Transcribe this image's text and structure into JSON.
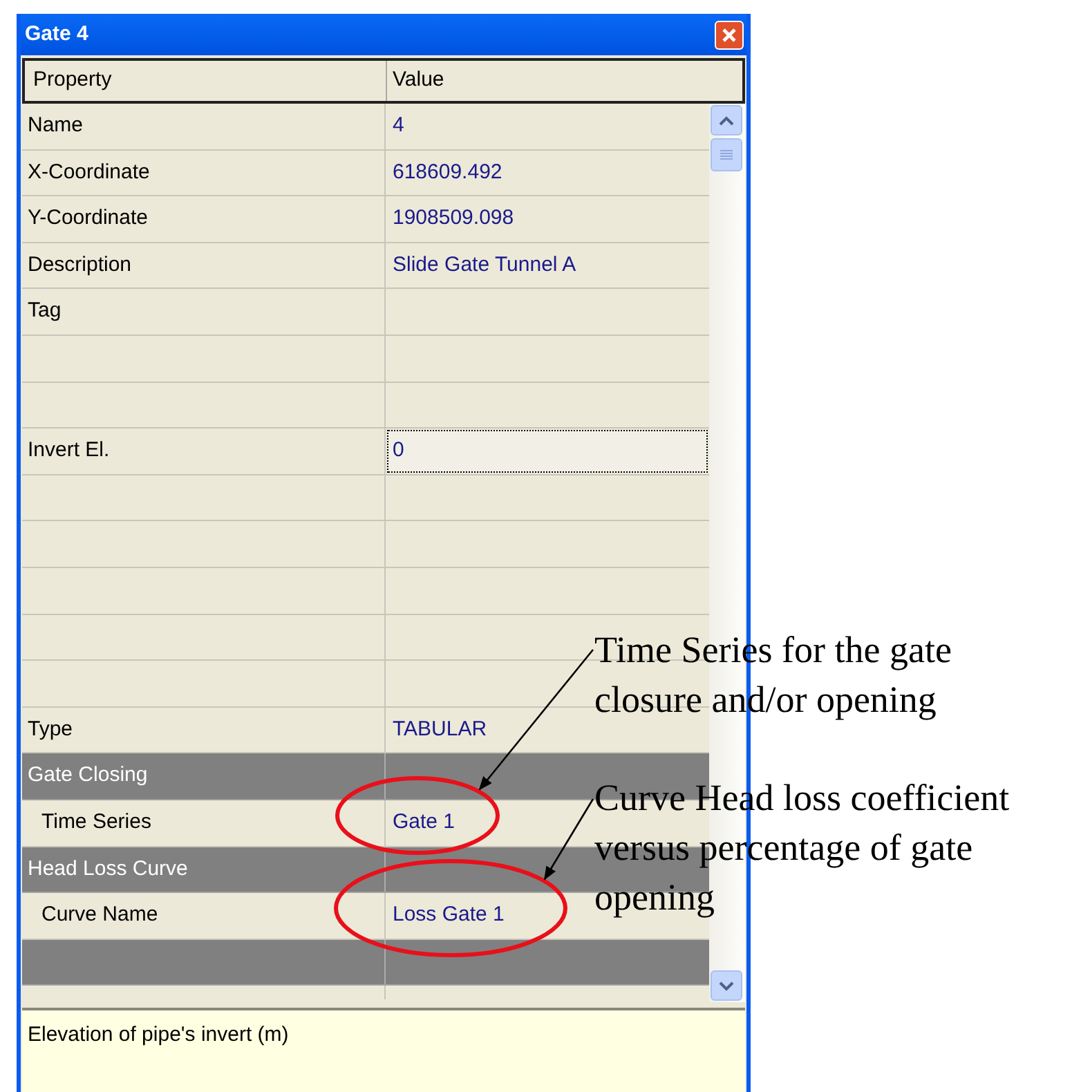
{
  "window": {
    "title": "Gate 4"
  },
  "grid": {
    "columns": [
      "Property",
      "Value"
    ],
    "rows": [
      {
        "kind": "property",
        "label": "Name",
        "value": "4",
        "indented": false,
        "selected": false
      },
      {
        "kind": "property",
        "label": "X-Coordinate",
        "value": "618609.492",
        "indented": false,
        "selected": false
      },
      {
        "kind": "property",
        "label": "Y-Coordinate",
        "value": "1908509.098",
        "indented": false,
        "selected": false
      },
      {
        "kind": "property",
        "label": "Description",
        "value": "Slide Gate Tunnel A",
        "indented": false,
        "selected": false
      },
      {
        "kind": "property",
        "label": "Tag",
        "indented": false,
        "selected": false
      },
      {
        "kind": "property",
        "selected": false
      },
      {
        "kind": "property",
        "selected": false
      },
      {
        "kind": "property",
        "label": "Invert El.",
        "value": "0",
        "indented": false,
        "selected": true
      },
      {
        "kind": "property",
        "selected": false
      },
      {
        "kind": "property",
        "selected": false
      },
      {
        "kind": "property",
        "selected": false
      },
      {
        "kind": "property",
        "selected": false
      },
      {
        "kind": "property",
        "selected": false
      },
      {
        "kind": "property",
        "label": "Type",
        "value": "TABULAR",
        "indented": false,
        "selected": false
      },
      {
        "kind": "category",
        "label": "Gate Closing"
      },
      {
        "kind": "property",
        "label": "Time Series",
        "value": "Gate 1",
        "indented": true,
        "selected": false
      },
      {
        "kind": "category",
        "label": "Head Loss Curve"
      },
      {
        "kind": "property",
        "label": "Curve Name",
        "value": "Loss Gate 1",
        "indented": true,
        "selected": false
      },
      {
        "kind": "category"
      }
    ]
  },
  "description": "Elevation of pipe's invert (m)",
  "annotations": [
    {
      "lines": [
        "Time Series for the gate",
        "closure and/or opening"
      ]
    },
    {
      "lines": [
        "Curve Head loss coefficient",
        "versus percentage of gate",
        "opening"
      ]
    }
  ]
}
